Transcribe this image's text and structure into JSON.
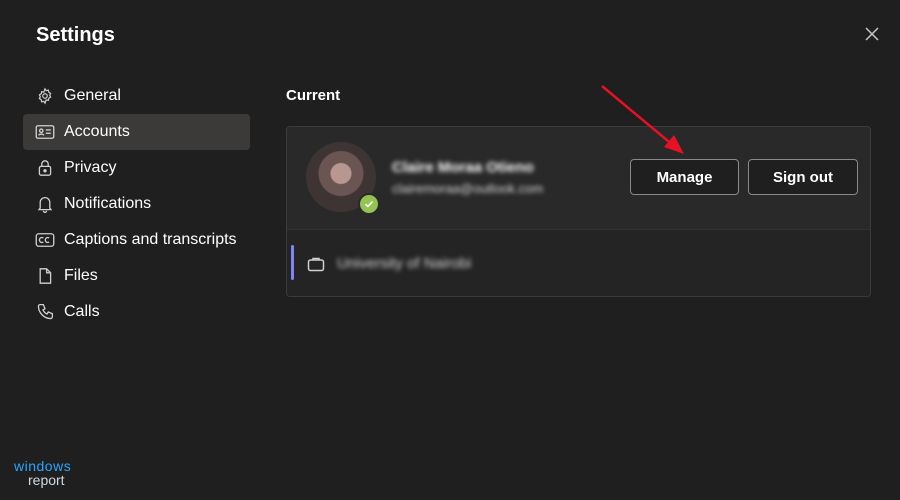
{
  "header": {
    "title": "Settings"
  },
  "sidebar": {
    "items": [
      {
        "label": "General",
        "icon": "gear-icon",
        "active": false
      },
      {
        "label": "Accounts",
        "icon": "id-card-icon",
        "active": true
      },
      {
        "label": "Privacy",
        "icon": "lock-icon",
        "active": false
      },
      {
        "label": "Notifications",
        "icon": "bell-icon",
        "active": false
      },
      {
        "label": "Captions and transcripts",
        "icon": "cc-icon",
        "active": false
      },
      {
        "label": "Files",
        "icon": "file-icon",
        "active": false
      },
      {
        "label": "Calls",
        "icon": "phone-icon",
        "active": false
      }
    ]
  },
  "main": {
    "section_title": "Current",
    "account": {
      "name": "Claire Moraa Otieno",
      "email": "clairemoraa@outlook.com",
      "status": "available",
      "manage_label": "Manage",
      "signout_label": "Sign out",
      "organization": "University of Nairobi"
    }
  },
  "watermark": {
    "line1": "windows",
    "line2": "report"
  },
  "colors": {
    "background": "#1f1f1f",
    "active_nav": "#3b3a39",
    "card": "#292929",
    "presence": "#92c353",
    "org_accent": "#7f85f5",
    "annotation_arrow": "#e81123",
    "watermark": "#2aa5ff"
  }
}
